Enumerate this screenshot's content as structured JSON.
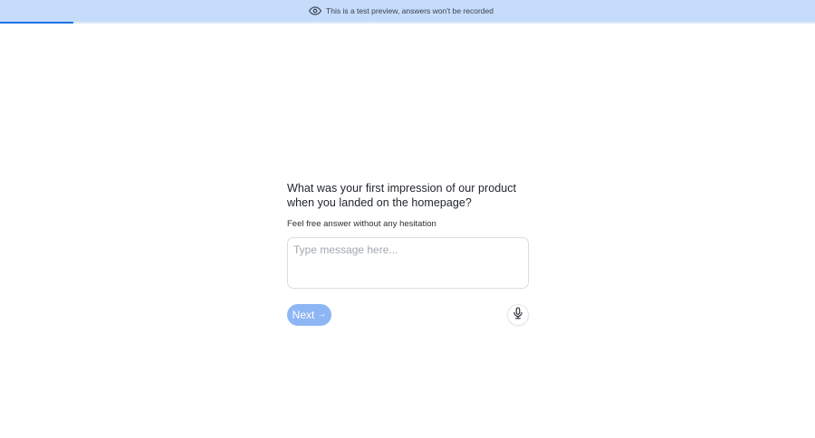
{
  "banner": {
    "text": "This is a test preview, answers won't be recorded",
    "icon": "eye-icon",
    "background": "#c5dcfb"
  },
  "progress": {
    "fraction": 0.09,
    "color": "#1a73e8"
  },
  "question": {
    "text": "What was your first impression of our product when you landed on the homepage?",
    "hint": "Feel free answer without any hesitation"
  },
  "message": {
    "placeholder": "Type message here...",
    "value": ""
  },
  "actions": {
    "next_label": "Next",
    "next_icon": "arrow-right-icon",
    "mic_icon": "microphone-icon",
    "accent": "#8eb6f5"
  }
}
